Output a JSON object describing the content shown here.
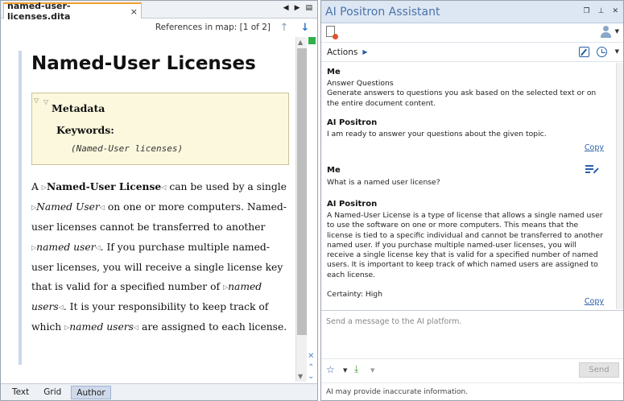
{
  "editor": {
    "tab_label": "named-user-licenses.dita",
    "tab_close": "×",
    "references_label": "References in map: [1 of 2]",
    "title": "Named-User Licenses",
    "metadata_title": "Metadata",
    "keywords_title": "Keywords:",
    "keywords_value": "(Named-User licenses)",
    "para": {
      "t1": "A ",
      "b1": "Named-User License",
      "t2": " can be used by a single ",
      "i1": "Named User",
      "t3": " on one or more computers. Named-user licenses cannot be transferred to another ",
      "i2": "named user",
      "t4": ". If you purchase multiple named-user licenses, you will receive a single license key that is valid for a specified number of ",
      "i3": "named users",
      "t5": ". It is your responsibility to keep track of which ",
      "i4": "named users",
      "t6": " are assigned to each license."
    },
    "mode_tabs": [
      "Text",
      "Grid",
      "Author"
    ],
    "active_mode": "Author"
  },
  "assistant": {
    "title": "AI Positron Assistant",
    "actions_label": "Actions",
    "messages": [
      {
        "sender": "Me",
        "lines": [
          "Answer Questions",
          "Generate answers to questions you ask based on the selected text or on the entire document content."
        ]
      },
      {
        "sender": "AI Positron",
        "text": "I am ready to answer your questions about the given topic.",
        "copy": "Copy"
      },
      {
        "sender": "Me",
        "text": "What is a named user license?"
      },
      {
        "sender": "AI Positron",
        "text": "A Named-User License is a type of license that allows a single named user to use the software on one or more computers. This means that the license is tied to a specific individual and cannot be transferred to another named user. If you purchase multiple named-user licenses, you will receive a single license key that is valid for a specified number of named users. It is important to keep track of which named users are assigned to each license.",
        "certainty": "Certainty: High",
        "copy": "Copy"
      }
    ],
    "input_placeholder": "Send a message to the AI platform.",
    "send_label": "Send",
    "disclaimer": "AI may provide inaccurate information."
  }
}
